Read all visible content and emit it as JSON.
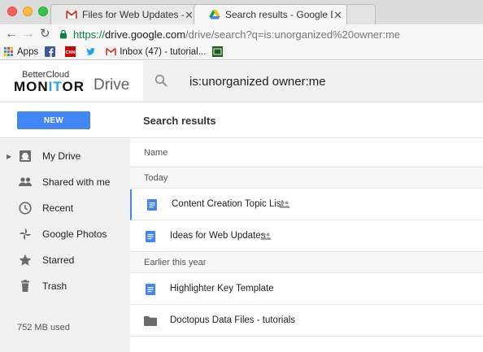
{
  "browser": {
    "tabs": [
      {
        "title": "Files for Web Updates - Invitati",
        "active": false,
        "icon": "gmail-icon"
      },
      {
        "title": "Search results - Google Drive",
        "active": true,
        "icon": "google-drive-icon"
      }
    ],
    "url": {
      "scheme": "https://",
      "host": "drive.google.com",
      "path": "/drive/search?q=is:unorganized%20owner:me"
    },
    "bookmarks": [
      {
        "label": "Apps",
        "icon": "apps-grid-icon"
      },
      {
        "label": "",
        "icon": "facebook-icon"
      },
      {
        "label": "",
        "icon": "cnn-icon"
      },
      {
        "label": "",
        "icon": "twitter-icon"
      },
      {
        "label": "Inbox (47) - tutorial...",
        "icon": "gmail-icon"
      },
      {
        "label": "",
        "icon": "bookmark-badge-icon"
      }
    ]
  },
  "header": {
    "brand_top": "BetterCloud",
    "brand_main_a": "MON",
    "brand_main_b": "IT",
    "brand_main_c": "OR",
    "brand_product": "Drive",
    "search_query": "is:unorganized owner:me"
  },
  "actions": {
    "new_label": "NEW",
    "page_title": "Search results"
  },
  "sidebar": {
    "items": [
      {
        "label": "My Drive",
        "icon": "drive-icon",
        "expandable": true
      },
      {
        "label": "Shared with me",
        "icon": "people-icon"
      },
      {
        "label": "Recent",
        "icon": "clock-icon"
      },
      {
        "label": "Google Photos",
        "icon": "pinwheel-icon"
      },
      {
        "label": "Starred",
        "icon": "star-icon"
      },
      {
        "label": "Trash",
        "icon": "trash-icon"
      }
    ],
    "storage": "752 MB used"
  },
  "list": {
    "column_name": "Name",
    "sections": [
      {
        "title": "Today",
        "files": [
          {
            "name": "Content Creation Topic List",
            "type": "doc",
            "shared": true,
            "selected": true
          },
          {
            "name": "Ideas for Web Updates",
            "type": "doc",
            "shared": true,
            "selected": false
          }
        ]
      },
      {
        "title": "Earlier this year",
        "files": [
          {
            "name": "Highlighter Key Template",
            "type": "doc",
            "shared": false,
            "selected": false
          },
          {
            "name": "Doctopus Data Files - tutorials",
            "type": "folder",
            "shared": false,
            "selected": false
          }
        ]
      }
    ]
  },
  "colors": {
    "accent_blue": "#4285f4",
    "sidebar_bg": "#f1f1f1",
    "monitor_it": "#2a9ff2"
  }
}
